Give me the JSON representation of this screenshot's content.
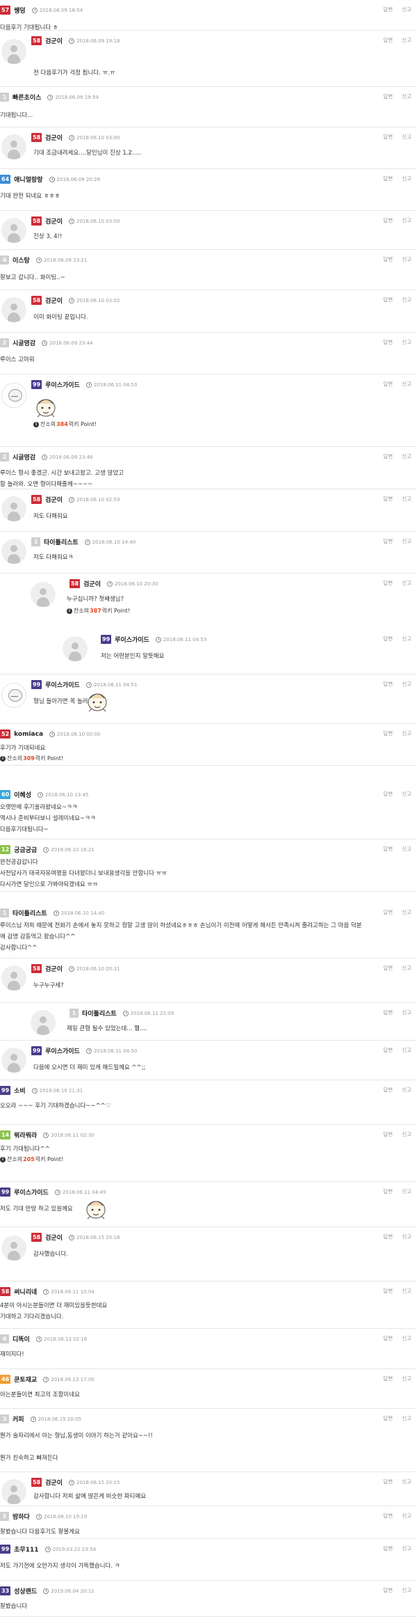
{
  "ui": {
    "reply": "답변",
    "report": "신고",
    "clock_icon": "clock-icon",
    "point_icon": "info-icon"
  },
  "level_colors": {
    "57": "#cc2c37",
    "58": "#cc2c37",
    "1": "#cfcfcf",
    "4": "#cfcfcf",
    "2": "#cfcfcf",
    "5": "#cfcfcf",
    "3": "#cfcfcf",
    "64": "#3b8fd8",
    "99": "#4b3c8c",
    "52": "#cc2c37",
    "60": "#3aa6dd",
    "12": "#8bc34a",
    "14": "#8bc34a",
    "46": "#f0a032",
    "33": "#4b3c8c"
  },
  "comments": [
    {
      "level": "57",
      "nick": "쌩덩",
      "date": "2018.06.09 18:54",
      "text": [
        "다음후기 기대됩니다 ㅎ"
      ]
    },
    {
      "level": "58",
      "nick": "검군이",
      "date": "2018.06.09 19:18",
      "text": [
        "전 다음후기가 걱정 됩니다. ㅠ.ㅠ"
      ]
    },
    {
      "level": "1",
      "nick": "빠른초이스",
      "date": "2018.06.09 19:54",
      "text": [
        "기대됩니다..."
      ]
    },
    {
      "level": "58",
      "nick": "검군이",
      "date": "2018.06.10 03:00",
      "text": [
        "기대 조금내려세요....달인님이 진상 1,2....."
      ]
    },
    {
      "level": "64",
      "nick": "애니멀랑랑",
      "date": "2018.06.09 20:28",
      "text": [
        "기대 완전 되네요 ㅎㅎㅎ"
      ]
    },
    {
      "level": "58",
      "nick": "검군이",
      "date": "2018.06.10 03:00",
      "text": [
        "진상 3, 4!!"
      ]
    },
    {
      "level": "4",
      "nick": "이스탕",
      "date": "2018.06.09 23:21",
      "text": [
        "잘보고 갑니다.. 화이팅..~"
      ]
    },
    {
      "level": "58",
      "nick": "검군이",
      "date": "2018.06.10 03:02",
      "text": [
        "이미 화이팅 끝입니다."
      ]
    },
    {
      "level": "2",
      "nick": "시골영감",
      "date": "2018.06.09 23:44",
      "text": [
        "루이스 고마워"
      ]
    },
    {
      "level": "99",
      "nick": "루이스가이드",
      "date": "2018.06.11 04:53",
      "text": [],
      "point": "384"
    },
    {
      "level": "2",
      "nick": "시골영감",
      "date": "2018.06.09 23:46",
      "text": [
        "루이스 형시 좋겠군. 시간 보내고왔고. 고생 많았고",
        "함 놀러와.  오면 형이다해줄께~~~~"
      ]
    },
    {
      "level": "58",
      "nick": "검군이",
      "date": "2018.06.10 02:59",
      "text": [
        "저도 다해줘요"
      ]
    },
    {
      "level": "1",
      "nick": "타이틀리스트",
      "date": "2018.06.10 14:40",
      "text": [
        "저도 다해줘요ㅋ"
      ]
    },
    {
      "level": "58",
      "nick": "검군이",
      "date": "2018.06.10 20:30",
      "text": [
        "누구십니까? 첫째생님?"
      ],
      "point": "387"
    },
    {
      "level": "99",
      "nick": "루이스가이드",
      "date": "2018.06.11 04:53",
      "text": [
        "저는 어떤분인지 알듯해요"
      ]
    },
    {
      "level": "99",
      "nick": "루이스가이드",
      "date": "2018.06.11 04:51",
      "text": [
        "형님 들아가면 꼭 놀러 갈께요"
      ]
    },
    {
      "level": "52",
      "nick": "komiaca",
      "date": "2018.06.10 00:00",
      "text": [
        "후기가 기대되네요"
      ],
      "point": "309"
    },
    {
      "level": "60",
      "nick": "이혜성",
      "date": "2018.06.10 13:45",
      "text": [
        "오랫만에 후기올라왔네요~ㅋㅋ",
        "역시나 준비부터보니 설레이네요~ㅋㅋ",
        "다음후기대됩니다~"
      ]
    },
    {
      "level": "12",
      "nick": "궁금궁금",
      "date": "2018.06.10 18:21",
      "text": [
        "완전공감갑니다",
        "사전답사가 태국자유여행을 다녀왔더니 보내용생각을 안합니다 ㅠㅠ",
        "다시가면 달인으로 가봐야되겠네요 ㅠㅠ"
      ]
    },
    {
      "level": "1",
      "nick": "타이틀리스트",
      "date": "2018.06.10 14:40",
      "text": [
        "루이스님 저희 때문에 전화기 손에서 놓지 못하고 정말 고생 많이 하셨네요ㅎㅎㅎ   손님이기 이전에 어떻게 해서든 만족시켜 줄려고하는 그 마음 덕분",
        "에 감명 감동먹고 왔습니다^^",
        "감사합니다^^"
      ]
    },
    {
      "level": "58",
      "nick": "검군이",
      "date": "2018.06.10 20:31",
      "text": [
        "누구누구세?"
      ]
    },
    {
      "level": "1",
      "nick": "타이틀리스트",
      "date": "2018.06.11 22:09",
      "text": [
        "제일 큰형 될수 있었는데...  햄...."
      ]
    },
    {
      "level": "99",
      "nick": "루이스가이드",
      "date": "2018.06.11 04:50",
      "text": [
        "다음에 오시면 더 재미 있게 해드릴께요 ^^;;"
      ]
    },
    {
      "level": "99",
      "nick": "소비",
      "date": "2018.06.10 21:31",
      "text": [
        "오오라 ~~~ 후기 기대하겠습니다~~^^♡"
      ]
    },
    {
      "level": "14",
      "nick": "뭐라뭐라",
      "date": "2018.06.11 02:30",
      "text": [
        "후기 기대됩니다^^"
      ],
      "point": "205"
    },
    {
      "level": "99",
      "nick": "루이스가이드",
      "date": "2018.06.11 04:49",
      "text": [
        "저도 기대 만땅 하고 있을께요"
      ]
    },
    {
      "level": "58",
      "nick": "검군이",
      "date": "2018.06.15 20:18",
      "text": [
        "감사했습니다."
      ]
    },
    {
      "level": "58",
      "nick": "써니리네",
      "date": "2018.06.11 10:04",
      "text": [
        "4분이 아시는분들이면 더 재미있을듯한데요",
        "기대하고 기다리겠습니다."
      ]
    },
    {
      "level": "4",
      "nick": "디똑이",
      "date": "2018.06.13 02:16",
      "text": [
        "재미지다!"
      ]
    },
    {
      "level": "46",
      "nick": "쿤토재교",
      "date": "2018.06.13 17:00",
      "text": [
        "아는분들이면 최고의 조합이네요"
      ]
    },
    {
      "level": "3",
      "nick": "커피",
      "date": "2018.06.15 20:05",
      "text": [
        "뭔가 술자리에서 아는 형님,동생이 이야기 하는거 같아요~~!!",
        "",
        "뭔가 친숙하고 빠져든다"
      ]
    },
    {
      "level": "58",
      "nick": "검군이",
      "date": "2018.06.15 20:15",
      "text": [
        "감사합니다 저희 삶에 많은게 비슷한   파티예요"
      ]
    },
    {
      "level": "5",
      "nick": "밤하다",
      "date": "2018.08.10 19:19",
      "text": [
        "잘봤습니다 다음후기도 잘볼게요"
      ]
    },
    {
      "level": "99",
      "nick": "초무111",
      "date": "2019.03.22 23:54",
      "text": [
        "저도 가기전에 오만가지 생각이 가득했습니다. ㅋ"
      ]
    },
    {
      "level": "33",
      "nick": "성상랜드",
      "date": "2019.06.04 20:11",
      "text": [
        "잘봤습니다"
      ]
    }
  ],
  "point_label": {
    "prefix": "잔소의",
    "suffix": "럭키 Point!"
  }
}
